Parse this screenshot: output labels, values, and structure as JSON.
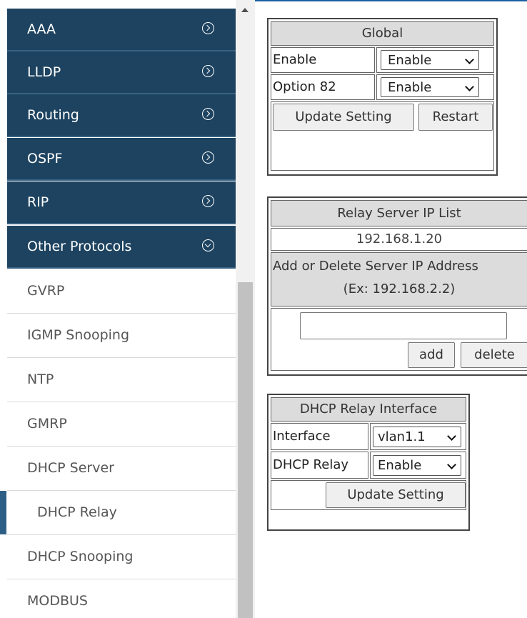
{
  "sidebar": {
    "groups": [
      {
        "label": "AAA"
      },
      {
        "label": "LLDP"
      },
      {
        "label": "Routing"
      },
      {
        "label": "OSPF"
      },
      {
        "label": "RIP"
      },
      {
        "label": "Other Protocols"
      }
    ],
    "items": [
      {
        "label": "GVRP"
      },
      {
        "label": "IGMP Snooping"
      },
      {
        "label": "NTP"
      },
      {
        "label": "GMRP"
      },
      {
        "label": "DHCP Server"
      },
      {
        "label": "DHCP Relay"
      },
      {
        "label": "DHCP Snooping"
      },
      {
        "label": "MODBUS"
      }
    ]
  },
  "global": {
    "title": "Global",
    "enable_label": "Enable",
    "enable_value": "Enable",
    "option82_label": "Option 82",
    "option82_value": "Enable",
    "update_button": "Update Setting",
    "restart_button": "Restart"
  },
  "relay_server": {
    "title": "Relay Server IP List",
    "ip": "192.168.1.20",
    "add_delete_header": "Add or Delete Server IP Address",
    "example": "(Ex: 192.168.2.2)",
    "input_value": "",
    "add_button": "add",
    "delete_button": "delete"
  },
  "relay_interface": {
    "title": "DHCP Relay Interface",
    "interface_label": "Interface",
    "interface_value": "vlan1.1",
    "relay_label": "DHCP Relay",
    "relay_value": "Enable",
    "update_button": "Update Setting"
  }
}
